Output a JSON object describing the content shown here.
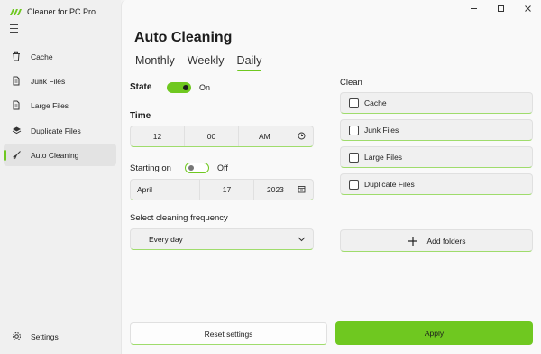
{
  "app": {
    "title": "Cleaner for PC Pro"
  },
  "colors": {
    "accent": "#6fc820",
    "accent_dark": "#1c1c1c",
    "sidebar_bg": "#f0f0f0",
    "content_bg": "#f9f9f9"
  },
  "sidebar": {
    "items": [
      {
        "label": "Cache",
        "icon": "trash-icon"
      },
      {
        "label": "Junk Files",
        "icon": "file-icon"
      },
      {
        "label": "Large Files",
        "icon": "file-icon"
      },
      {
        "label": "Duplicate Files",
        "icon": "layers-icon"
      },
      {
        "label": "Auto Cleaning",
        "icon": "broom-icon",
        "active": true
      }
    ],
    "settings_label": "Settings"
  },
  "main": {
    "title": "Auto Cleaning",
    "tabs": [
      {
        "label": "Monthly"
      },
      {
        "label": "Weekly"
      },
      {
        "label": "Daily",
        "active": true
      }
    ],
    "state": {
      "label": "State",
      "value": "On",
      "on": true
    },
    "time": {
      "label": "Time",
      "hour": "12",
      "minute": "00",
      "period": "AM"
    },
    "starting_on": {
      "label": "Starting on",
      "value": "Off",
      "on": false,
      "month": "April",
      "day": "17",
      "year": "2023"
    },
    "frequency": {
      "label": "Select cleaning frequency",
      "value": "Every day"
    },
    "clean": {
      "label": "Clean",
      "items": [
        {
          "label": "Cache",
          "checked": false
        },
        {
          "label": "Junk Files",
          "checked": false
        },
        {
          "label": "Large Files",
          "checked": false
        },
        {
          "label": "Duplicate Files",
          "checked": false
        }
      ],
      "add_folders_label": "Add folders"
    },
    "reset_label": "Reset settings",
    "apply_label": "Apply"
  }
}
